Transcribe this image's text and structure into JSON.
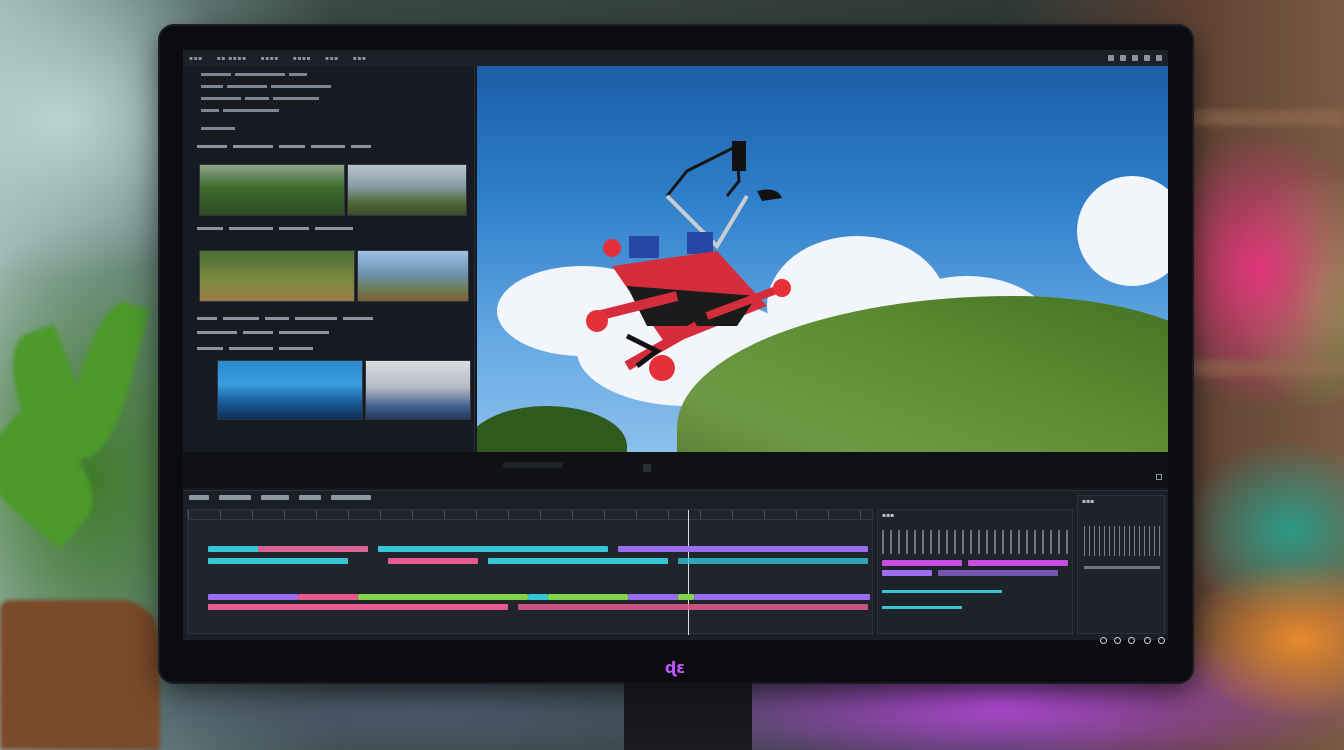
{
  "app": {
    "menu": [
      "▪▪▪",
      "▪▪ ▪▪▪▪",
      "▪▪▪▪",
      "▪▪▪▪",
      "▪▪▪",
      "▪▪▪"
    ]
  },
  "media_panel": {
    "clip_groups": [
      {
        "name": "clip-group-1",
        "thumbs": [
          "forest-hill-thumb",
          "field-sky-thumb"
        ]
      },
      {
        "name": "clip-group-2",
        "thumbs": [
          "drone-ground-thumb",
          "landscape-thumb"
        ]
      },
      {
        "name": "clip-group-3",
        "thumbs": [
          "blue-sky-thumb",
          "bright-sky-thumb"
        ]
      }
    ]
  },
  "timeline": {
    "track_colors": {
      "cyan": "#35c7d6",
      "pink": "#e85a8e",
      "violet": "#9b6ef0",
      "green": "#7fd44a",
      "magenta": "#c84de0"
    }
  },
  "logo": {
    "text": "ɖɛ"
  },
  "colors": {
    "accent": "#c455ff",
    "bezel": "#0b0c10"
  }
}
